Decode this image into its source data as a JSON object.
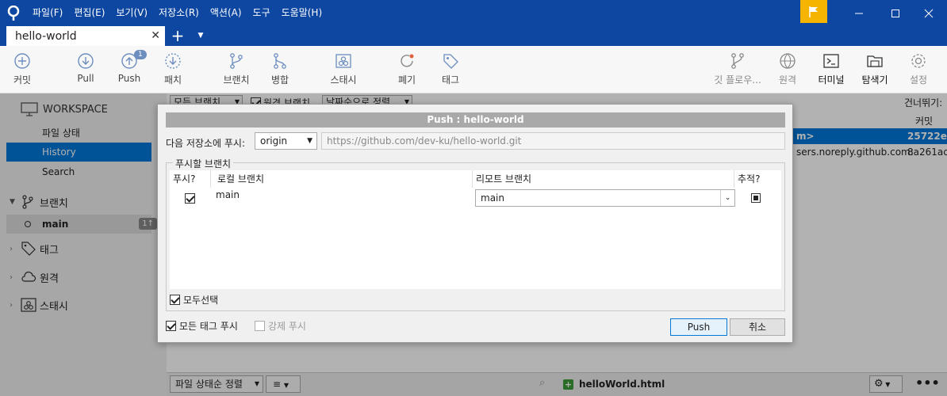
{
  "menu": [
    "파일(F)",
    "편집(E)",
    "보기(V)",
    "저장소(R)",
    "액션(A)",
    "도구",
    "도움말(H)"
  ],
  "tab": {
    "title": "hello-world"
  },
  "toolbar": {
    "commit": "커밋",
    "pull": "Pull",
    "push": "Push",
    "push_badge": "1",
    "fetch": "패치",
    "branch": "브랜치",
    "merge": "병합",
    "stash": "스태시",
    "discard": "폐기",
    "tag": "태그",
    "gitflow": "깃 플로우...",
    "remote": "원격",
    "terminal": "터미널",
    "explorer": "탐색기",
    "settings": "설정"
  },
  "sidebar": {
    "workspace": "WORKSPACE",
    "file_status": "파일 상태",
    "history": "History",
    "search": "Search",
    "branches": "브랜치",
    "main_branch": "main",
    "main_badge": "1↑",
    "tags": "태그",
    "remotes": "원격",
    "stashes": "스태시"
  },
  "bg": {
    "filter_all": "모든 브랜치",
    "remote_branches": "원격 브랜치",
    "sort": "날짜순으로 정렬",
    "skip": "건너뛰기:",
    "col_commit": "커밋",
    "row1_text": "m>",
    "row1_hash": "25722e4",
    "row2_text": "sers.noreply.github.com:",
    "row2_hash": "8a261ac",
    "status_sort": "파일 상태순 정렬",
    "status_file": "helloWorld.html"
  },
  "dialog": {
    "title": "Push :  hello-world",
    "remote_label": "다음 저장소에 푸시:",
    "remote_value": "origin",
    "remote_url": "https://github.com/dev-ku/hello-world.git",
    "group_title": "푸시할 브랜치",
    "headers": [
      "푸시?",
      "로컬 브랜치",
      "리모트 브랜치",
      "추적?"
    ],
    "row": {
      "local": "main",
      "remote": "main"
    },
    "select_all": "모두선택",
    "push_all_tags": "모든 태그 푸시",
    "force_push": "강제 푸시",
    "push_button": "Push",
    "cancel_button": "취소"
  },
  "colors": {
    "titlebar": "#0d47a1",
    "accent": "#0078d7",
    "flag": "#f4b400"
  }
}
